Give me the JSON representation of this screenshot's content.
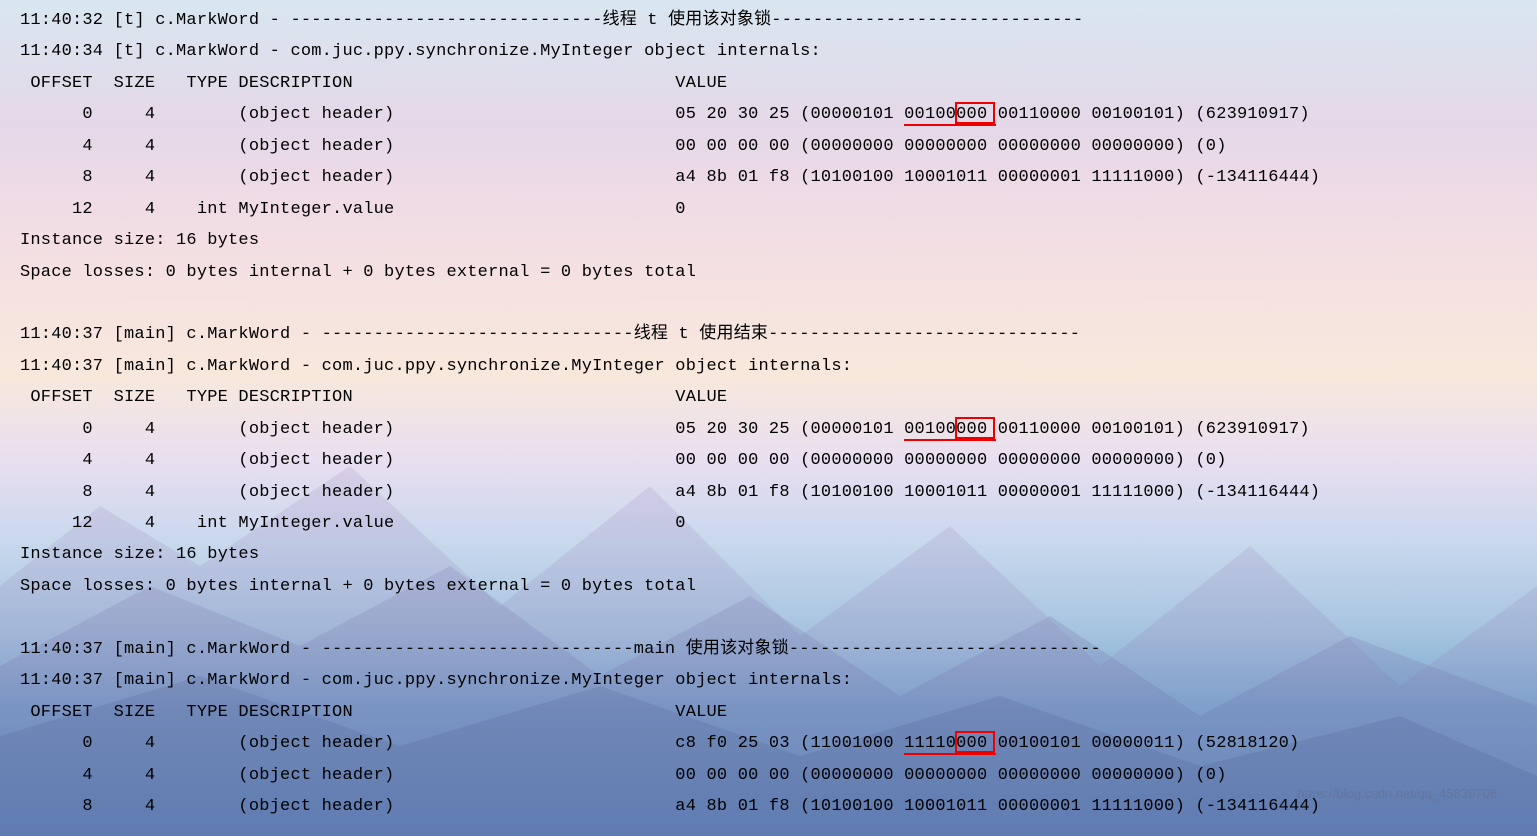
{
  "blocks": [
    {
      "headers": [
        "11:40:32 [t] c.MarkWord - ------------------------------线程 t 使用该对象锁------------------------------",
        "11:40:34 [t] c.MarkWord - com.juc.ppy.synchronize.MyInteger object internals:",
        " OFFSET  SIZE   TYPE DESCRIPTION                               VALUE"
      ],
      "rows": [
        {
          "offset": "0",
          "size": "4",
          "type": "",
          "desc": "(object header)",
          "hex": "05 20 30 25",
          "bin": "(00000101 00100000 00110000 00100101)",
          "dec": "(623910917)",
          "hl": true
        },
        {
          "offset": "4",
          "size": "4",
          "type": "",
          "desc": "(object header)",
          "hex": "00 00 00 00",
          "bin": "(00000000 00000000 00000000 00000000)",
          "dec": "(0)"
        },
        {
          "offset": "8",
          "size": "4",
          "type": "",
          "desc": "(object header)",
          "hex": "a4 8b 01 f8",
          "bin": "(10100100 10001011 00000001 11111000)",
          "dec": "(-134116444)"
        },
        {
          "offset": "12",
          "size": "4",
          "type": "int",
          "desc": "MyInteger.value",
          "hex": "",
          "bin": "",
          "dec": "0",
          "simple": true
        }
      ],
      "footers": [
        "Instance size: 16 bytes",
        "Space losses: 0 bytes internal + 0 bytes external = 0 bytes total"
      ]
    },
    {
      "spacer": true,
      "headers": [
        "11:40:37 [main] c.MarkWord - ------------------------------线程 t 使用结束------------------------------",
        "11:40:37 [main] c.MarkWord - com.juc.ppy.synchronize.MyInteger object internals:",
        " OFFSET  SIZE   TYPE DESCRIPTION                               VALUE"
      ],
      "rows": [
        {
          "offset": "0",
          "size": "4",
          "type": "",
          "desc": "(object header)",
          "hex": "05 20 30 25",
          "bin": "(00000101 00100000 00110000 00100101)",
          "dec": "(623910917)",
          "hl": true
        },
        {
          "offset": "4",
          "size": "4",
          "type": "",
          "desc": "(object header)",
          "hex": "00 00 00 00",
          "bin": "(00000000 00000000 00000000 00000000)",
          "dec": "(0)"
        },
        {
          "offset": "8",
          "size": "4",
          "type": "",
          "desc": "(object header)",
          "hex": "a4 8b 01 f8",
          "bin": "(10100100 10001011 00000001 11111000)",
          "dec": "(-134116444)"
        },
        {
          "offset": "12",
          "size": "4",
          "type": "int",
          "desc": "MyInteger.value",
          "hex": "",
          "bin": "",
          "dec": "0",
          "simple": true
        }
      ],
      "footers": [
        "Instance size: 16 bytes",
        "Space losses: 0 bytes internal + 0 bytes external = 0 bytes total"
      ]
    },
    {
      "spacer": true,
      "headers": [
        "11:40:37 [main] c.MarkWord - ------------------------------main 使用该对象锁------------------------------",
        "11:40:37 [main] c.MarkWord - com.juc.ppy.synchronize.MyInteger object internals:",
        " OFFSET  SIZE   TYPE DESCRIPTION                               VALUE"
      ],
      "rows": [
        {
          "offset": "0",
          "size": "4",
          "type": "",
          "desc": "(object header)",
          "hex": "c8 f0 25 03",
          "bin": "(11001000 11110000 00100101 00000011)",
          "dec": "(52818120)",
          "hl": true
        },
        {
          "offset": "4",
          "size": "4",
          "type": "",
          "desc": "(object header)",
          "hex": "00 00 00 00",
          "bin": "(00000000 00000000 00000000 00000000)",
          "dec": "(0)"
        },
        {
          "offset": "8",
          "size": "4",
          "type": "",
          "desc": "(object header)",
          "hex": "a4 8b 01 f8",
          "bin": "(10100100 10001011 00000001 11111000)",
          "dec": "(-134116444)"
        }
      ],
      "footers": []
    }
  ],
  "watermark": "https://blog.csdn.net/qq_45839708",
  "highlightPositions": {
    "boxLeft": 935,
    "boxWidth": 40,
    "underlineLeft": 884,
    "underlineWidth": 92
  }
}
